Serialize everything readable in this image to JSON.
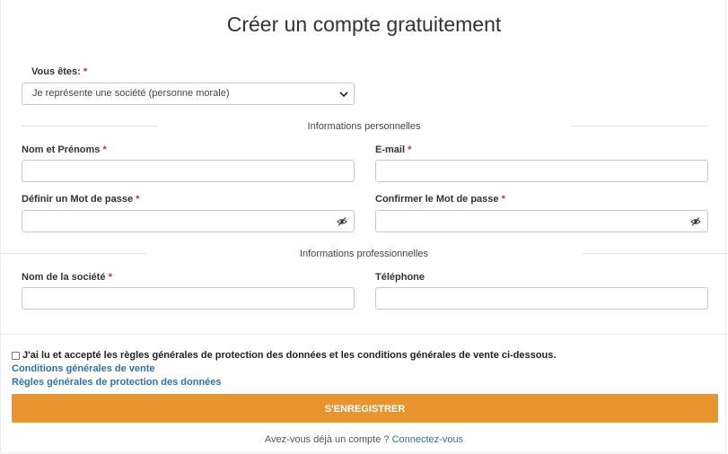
{
  "form": {
    "title": "Créer un compte gratuitement",
    "account_type": {
      "label": "Vous êtes:",
      "required_mark": "*",
      "selected": "Je représente une société (personne morale)"
    },
    "sections": {
      "personal": "Informations personnelles",
      "professional": "Informations professionnelles"
    },
    "fields": {
      "name": {
        "label": "Nom et Prénoms",
        "required_mark": "*",
        "value": ""
      },
      "email": {
        "label": "E-mail",
        "required_mark": "*",
        "value": ""
      },
      "password": {
        "label": "Définir un Mot de passe",
        "required_mark": "*",
        "value": ""
      },
      "confirm_password": {
        "label": "Confirmer le Mot de passe",
        "required_mark": "*",
        "value": ""
      },
      "company": {
        "label": "Nom de la société",
        "required_mark": "*",
        "value": ""
      },
      "phone": {
        "label": "Téléphone",
        "value": ""
      }
    },
    "consent": {
      "text": "J'ai lu et accepté les règles générales de protection des données et les conditions générales de vente ci-dessous.",
      "checked": false,
      "link_cgv": "Conditions générales de vente",
      "link_rgpd": "Règles générales de protection des données"
    },
    "submit_label": "S'ENREGISTRER",
    "footer": {
      "text": "Avez-vous déjà un compte ?",
      "link": "Connectez-vous"
    }
  },
  "colors": {
    "accent": "#e8952f",
    "link": "#2d73b0",
    "required": "#c9302c"
  },
  "icons": {
    "password_toggle": "eye-slash-icon",
    "select_arrow": "chevron-down-icon"
  }
}
